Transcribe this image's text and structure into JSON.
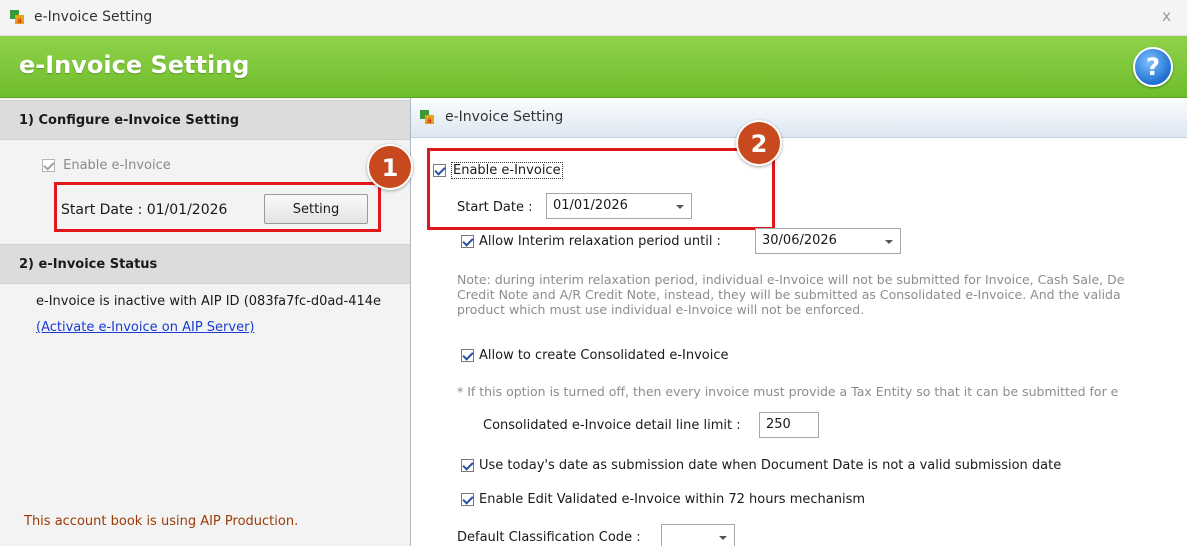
{
  "outer_window": {
    "title": "e-Invoice Setting",
    "close_glyph": "x",
    "banner_title": "e-Invoice Setting",
    "help_glyph": "?"
  },
  "left_panel": {
    "section1_title": "1) Configure e-Invoice Setting",
    "enable_label": "Enable e-Invoice",
    "enable_checked": true,
    "start_date_label": "Start Date : 01/01/2026",
    "setting_button": "Setting",
    "section2_title": "2) e-Invoice Status",
    "status_text": "e-Invoice is inactive with AIP ID (083fa7fc-d0ad-414e",
    "activate_link": "(Activate e-Invoice on AIP Server)",
    "footer_text": "This account book is using AIP Production."
  },
  "callouts": {
    "badge1": "1",
    "badge2": "2"
  },
  "inner_dialog": {
    "title": "e-Invoice Setting",
    "enable_label": "Enable e-Invoice",
    "start_date_label": "Start Date :",
    "start_date_value": "01/01/2026",
    "interim_label": "Allow Interim relaxation period until :",
    "interim_value": "30/06/2026",
    "note_line1": "Note: during interim relaxation period, individual e-Invoice will not be submitted for Invoice, Cash Sale, De",
    "note_line2": "Credit Note and A/R Credit Note, instead, they will be submitted as Consolidated e-Invoice. And the valida",
    "note_line3": "product which must use individual e-Invoice will not be enforced.",
    "consolidated_label": "Allow to create Consolidated e-Invoice",
    "consolidated_note": "* If this option is turned off, then every invoice must provide a Tax Entity so that it can be submitted for e",
    "limit_label": "Consolidated e-Invoice detail line limit :",
    "limit_value": "250",
    "todays_date_label": "Use today's date as submission date when Document Date is not a valid submission date",
    "edit_validated_label": "Enable Edit Validated e-Invoice within 72 hours mechanism",
    "classification_label": "Default Classification Code :",
    "classification_value": ""
  },
  "colors": {
    "banner_green": "#7cc63a",
    "highlight_red": "#e0171b",
    "badge_orange": "#c8491e",
    "link_blue": "#1a3bd1",
    "footer_brown": "#9a3b06"
  }
}
